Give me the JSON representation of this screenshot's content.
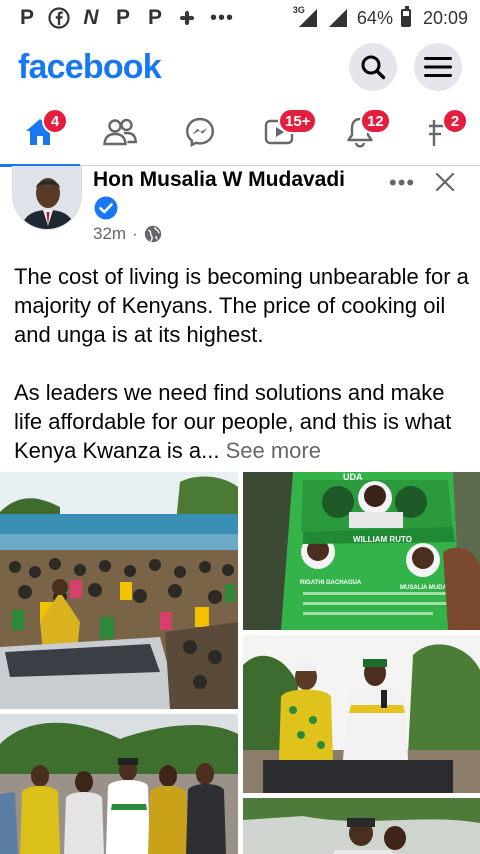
{
  "status_bar": {
    "notification_icons": [
      "P",
      "facebook-icon",
      "N",
      "P",
      "P",
      "pinwheel-icon"
    ],
    "overflow": "•••",
    "network": "3G",
    "battery_percent": "64%",
    "battery_level": 0.64,
    "time": "20:09"
  },
  "header": {
    "logo": "facebook"
  },
  "nav": {
    "home_badge": "4",
    "video_badge": "15+",
    "notifications_badge": "12",
    "marketplace_badge": "2"
  },
  "post": {
    "author": "Hon Musalia W Mudavadi",
    "time": "32m",
    "separator": "·",
    "more": "•••",
    "text_p1": "The cost of living is becoming unbearable for a majority of Kenyans. The price of cooking oil and unga is at its highest.",
    "text_p2": "As leaders we need find solutions and make life affordable for our people, and this is what Kenya Kwanza is a...",
    "see_more": "See more",
    "poster_text": {
      "top": "UDA",
      "name1": "WILLIAM RUTO",
      "name2": "RIGATHI GACHAGUA",
      "name3": "MUSALIA MUDAVADI"
    }
  },
  "colors": {
    "brand": "#1877f2",
    "badge": "#e41e3f",
    "muted": "#65676b"
  }
}
